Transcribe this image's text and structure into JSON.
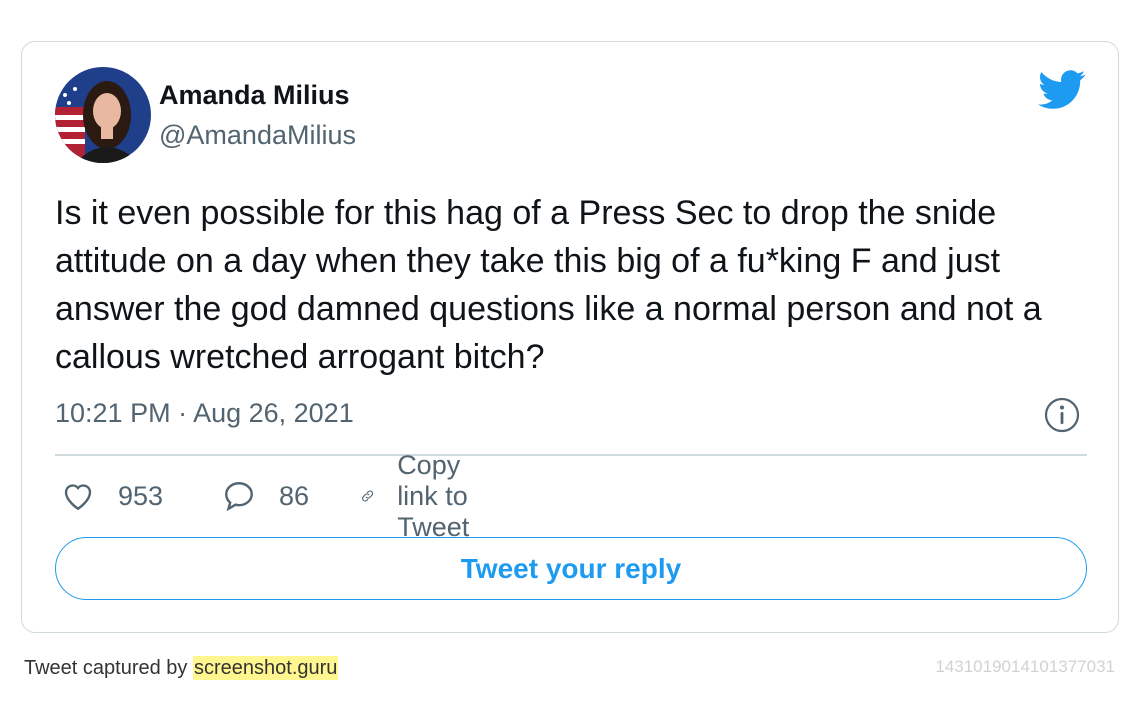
{
  "tweet": {
    "author_name": "Amanda Milius",
    "author_handle": "@AmandaMilius",
    "text": "Is it even possible for this hag of a Press Sec to drop the snide attitude on a day when they take this big of a fu*king F and just answer the god damned questions like a normal person and not a callous wretched arrogant bitch?",
    "timestamp": "10:21 PM · Aug 26, 2021",
    "likes": "953",
    "replies": "86",
    "copy_link_label": "Copy link to Tweet",
    "reply_button_label": "Tweet your reply"
  },
  "footer": {
    "captured_by": "Tweet captured by ",
    "brand": "screenshot.guru",
    "tweet_id": "1431019014101377031"
  },
  "colors": {
    "accent": "#1d9bf0",
    "secondary_text": "#536471",
    "border": "#cfd9de",
    "highlight": "#fff690"
  },
  "icons": {
    "brand": "twitter-bird-icon",
    "like": "heart-icon",
    "reply": "speech-bubble-icon",
    "copy": "link-icon",
    "info": "info-icon"
  }
}
